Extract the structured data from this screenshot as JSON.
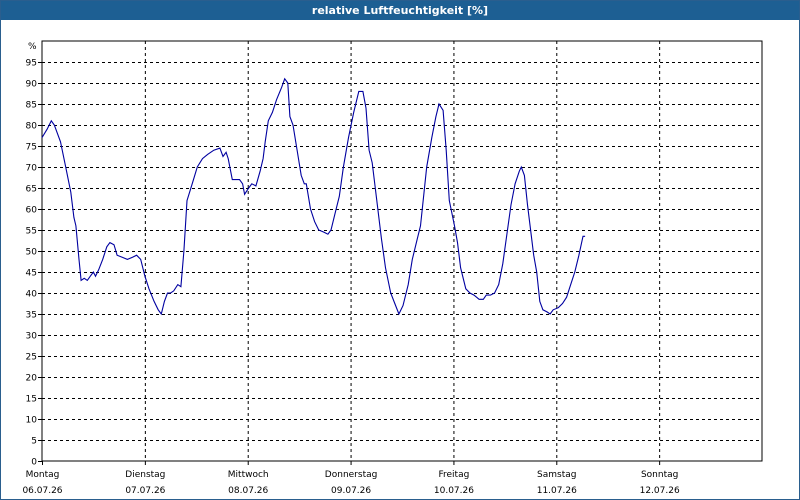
{
  "window": {
    "title": "relative Luftfeuchtigkeit [%]"
  },
  "chart_data": {
    "type": "line",
    "title": "relative Luftfeuchtigkeit [%]",
    "ylabel": "%",
    "ylim": [
      0,
      100
    ],
    "yticks": [
      0,
      5,
      10,
      15,
      20,
      25,
      30,
      35,
      40,
      45,
      50,
      55,
      60,
      65,
      70,
      75,
      80,
      85,
      90,
      95
    ],
    "xlim": [
      0,
      7
    ],
    "x_unit": "days since Montag 06.07.26 00:00",
    "grid": true,
    "line_color": "#0000a0",
    "days": [
      {
        "name": "Montag",
        "date": "06.07.26"
      },
      {
        "name": "Dienstag",
        "date": "07.07.26"
      },
      {
        "name": "Mittwoch",
        "date": "08.07.26"
      },
      {
        "name": "Donnerstag",
        "date": "09.07.26"
      },
      {
        "name": "Freitag",
        "date": "10.07.26"
      },
      {
        "name": "Samstag",
        "date": "11.07.26"
      },
      {
        "name": "Sonntag",
        "date": "12.07.26"
      }
    ],
    "series": [
      {
        "values": [
          [
            0.0,
            77
          ],
          [
            0.05,
            79
          ],
          [
            0.09,
            81
          ],
          [
            0.12,
            80
          ],
          [
            0.18,
            76
          ],
          [
            0.23,
            70
          ],
          [
            0.28,
            64
          ],
          [
            0.31,
            58
          ],
          [
            0.33,
            56
          ],
          [
            0.36,
            48
          ],
          [
            0.38,
            43
          ],
          [
            0.41,
            43.5
          ],
          [
            0.44,
            43
          ],
          [
            0.47,
            44
          ],
          [
            0.5,
            45
          ],
          [
            0.52,
            44
          ],
          [
            0.55,
            45.5
          ],
          [
            0.59,
            48
          ],
          [
            0.63,
            51
          ],
          [
            0.66,
            52
          ],
          [
            0.7,
            51.5
          ],
          [
            0.73,
            49
          ],
          [
            0.78,
            48.5
          ],
          [
            0.83,
            48
          ],
          [
            0.88,
            48.5
          ],
          [
            0.92,
            49
          ],
          [
            0.96,
            48
          ],
          [
            1.0,
            44
          ],
          [
            1.04,
            41
          ],
          [
            1.09,
            38
          ],
          [
            1.13,
            36
          ],
          [
            1.16,
            35
          ],
          [
            1.19,
            38
          ],
          [
            1.22,
            40
          ],
          [
            1.25,
            40
          ],
          [
            1.28,
            40.5
          ],
          [
            1.32,
            42
          ],
          [
            1.35,
            41.5
          ],
          [
            1.38,
            50
          ],
          [
            1.41,
            62
          ],
          [
            1.46,
            66
          ],
          [
            1.51,
            70
          ],
          [
            1.56,
            72
          ],
          [
            1.61,
            73
          ],
          [
            1.67,
            74
          ],
          [
            1.73,
            74.5
          ],
          [
            1.76,
            72.5
          ],
          [
            1.79,
            73.5
          ],
          [
            1.81,
            72
          ],
          [
            1.85,
            67
          ],
          [
            1.88,
            67
          ],
          [
            1.92,
            67
          ],
          [
            1.95,
            66
          ],
          [
            1.97,
            63.5
          ],
          [
            2.01,
            65
          ],
          [
            2.04,
            66
          ],
          [
            2.08,
            65.5
          ],
          [
            2.12,
            69
          ],
          [
            2.15,
            72
          ],
          [
            2.17,
            76
          ],
          [
            2.2,
            81
          ],
          [
            2.24,
            83
          ],
          [
            2.28,
            86
          ],
          [
            2.33,
            89
          ],
          [
            2.36,
            91
          ],
          [
            2.39,
            90
          ],
          [
            2.41,
            82
          ],
          [
            2.44,
            80
          ],
          [
            2.48,
            74
          ],
          [
            2.52,
            68
          ],
          [
            2.55,
            66
          ],
          [
            2.57,
            66
          ],
          [
            2.61,
            60
          ],
          [
            2.65,
            57
          ],
          [
            2.69,
            55
          ],
          [
            2.74,
            54.5
          ],
          [
            2.78,
            54
          ],
          [
            2.81,
            55
          ],
          [
            2.85,
            59
          ],
          [
            2.89,
            63
          ],
          [
            2.93,
            70
          ],
          [
            2.98,
            77
          ],
          [
            3.03,
            83
          ],
          [
            3.08,
            88
          ],
          [
            3.12,
            88
          ],
          [
            3.15,
            84
          ],
          [
            3.18,
            74
          ],
          [
            3.21,
            71
          ],
          [
            3.25,
            63
          ],
          [
            3.3,
            53
          ],
          [
            3.34,
            46
          ],
          [
            3.39,
            40
          ],
          [
            3.43,
            37.5
          ],
          [
            3.47,
            35
          ],
          [
            3.51,
            37
          ],
          [
            3.56,
            42
          ],
          [
            3.6,
            48
          ],
          [
            3.65,
            53
          ],
          [
            3.68,
            56
          ],
          [
            3.71,
            63
          ],
          [
            3.74,
            70
          ],
          [
            3.79,
            77
          ],
          [
            3.83,
            82
          ],
          [
            3.86,
            85
          ],
          [
            3.9,
            83.5
          ],
          [
            3.93,
            74
          ],
          [
            3.96,
            62
          ],
          [
            4.01,
            56
          ],
          [
            4.04,
            52
          ],
          [
            4.07,
            46
          ],
          [
            4.12,
            41
          ],
          [
            4.16,
            40
          ],
          [
            4.2,
            39.5
          ],
          [
            4.25,
            38.5
          ],
          [
            4.29,
            38.5
          ],
          [
            4.32,
            39.5
          ],
          [
            4.36,
            39.5
          ],
          [
            4.4,
            40
          ],
          [
            4.44,
            42
          ],
          [
            4.48,
            47
          ],
          [
            4.52,
            54
          ],
          [
            4.56,
            61
          ],
          [
            4.6,
            66
          ],
          [
            4.64,
            69
          ],
          [
            4.66,
            70
          ],
          [
            4.69,
            68
          ],
          [
            4.72,
            61
          ],
          [
            4.75,
            55
          ],
          [
            4.78,
            49
          ],
          [
            4.81,
            45
          ],
          [
            4.84,
            38
          ],
          [
            4.87,
            36
          ],
          [
            4.91,
            35.5
          ],
          [
            4.94,
            35
          ],
          [
            4.97,
            36
          ],
          [
            5.02,
            36.5
          ],
          [
            5.06,
            37.5
          ],
          [
            5.1,
            39
          ],
          [
            5.14,
            42
          ],
          [
            5.18,
            45
          ],
          [
            5.22,
            49
          ],
          [
            5.26,
            53.5
          ],
          [
            5.28,
            53.5
          ]
        ]
      }
    ]
  }
}
